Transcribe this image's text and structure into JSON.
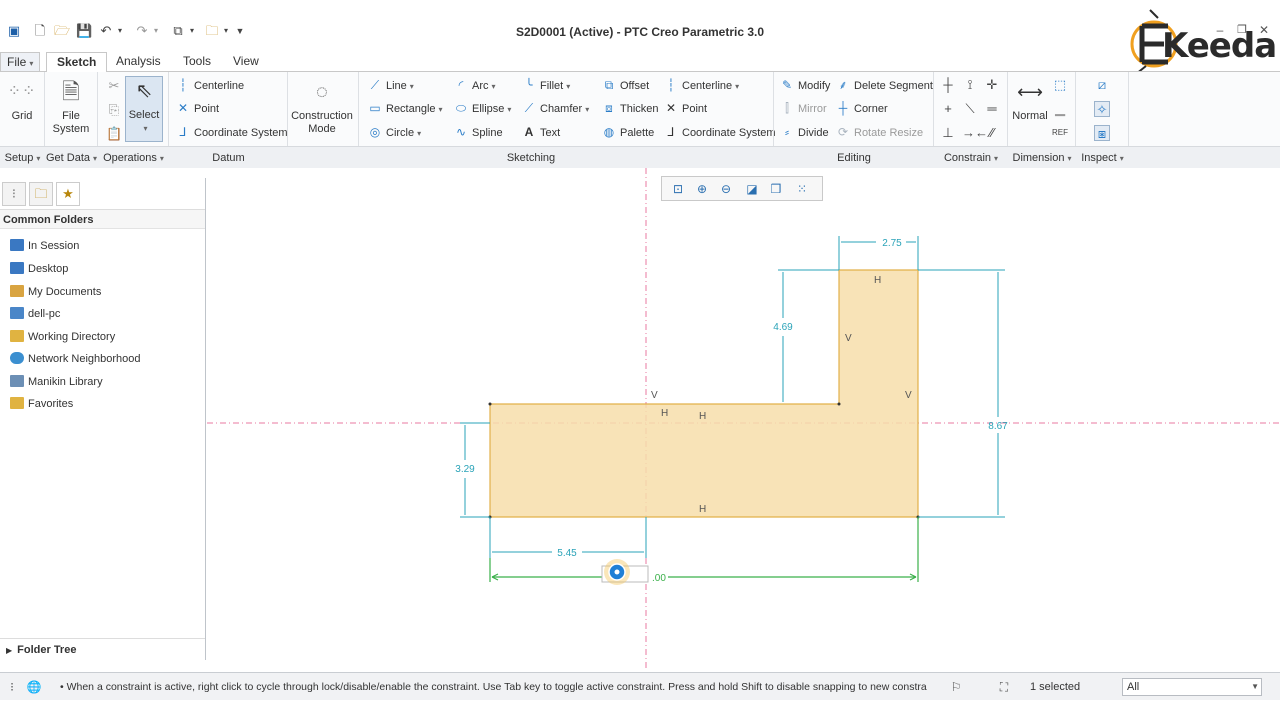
{
  "window": {
    "title": "S2D0001 (Active) - PTC Creo Parametric 3.0"
  },
  "logo": {
    "text": "Keeda"
  },
  "tabs": [
    {
      "label": "File"
    },
    {
      "label": "Sketch"
    },
    {
      "label": "Analysis"
    },
    {
      "label": "Tools"
    },
    {
      "label": "View"
    }
  ],
  "ribbon": {
    "setup": {
      "grid": "Grid",
      "group": "Setup"
    },
    "get_data": {
      "file_system_line1": "File",
      "file_system_line2": "System",
      "group": "Get Data"
    },
    "operations": {
      "select": "Select",
      "group": "Operations"
    },
    "datum": {
      "centerline": "Centerline",
      "point": "Point",
      "coordinate_system": "Coordinate System",
      "group": "Datum"
    },
    "construction": {
      "line1": "Construction",
      "line2": "Mode"
    },
    "sketching": {
      "line": "Line",
      "rectangle": "Rectangle",
      "circle": "Circle",
      "arc": "Arc",
      "ellipse": "Ellipse",
      "spline": "Spline",
      "fillet": "Fillet",
      "chamfer": "Chamfer",
      "text": "Text",
      "offset": "Offset",
      "thicken": "Thicken",
      "palette": "Palette",
      "centerline": "Centerline",
      "point": "Point",
      "coordinate_system": "Coordinate System",
      "group": "Sketching"
    },
    "editing": {
      "modify": "Modify",
      "mirror": "Mirror",
      "divide": "Divide",
      "delete_segment": "Delete Segment",
      "corner": "Corner",
      "rotate_resize": "Rotate Resize",
      "group": "Editing"
    },
    "constrain": {
      "group": "Constrain"
    },
    "dimension": {
      "normal": "Normal",
      "group": "Dimension"
    },
    "inspect": {
      "group": "Inspect"
    }
  },
  "left_pane": {
    "header": "Common Folders",
    "folders": [
      {
        "label": "In Session",
        "color": "#3a78c2"
      },
      {
        "label": "Desktop",
        "color": "#3a78c2"
      },
      {
        "label": "My Documents",
        "color": "#d9a441"
      },
      {
        "label": "dell-pc",
        "color": "#4a86c8"
      },
      {
        "label": "Working Directory",
        "color": "#e0b341"
      },
      {
        "label": "Network Neighborhood",
        "color": "#3b8fd0"
      },
      {
        "label": "Manikin Library",
        "color": "#6c8fb5"
      },
      {
        "label": "Favorites",
        "color": "#e0b341"
      }
    ],
    "footer": "Folder Tree"
  },
  "sketch": {
    "colors": {
      "fill": "#f7deaa",
      "edge": "#e2b14a",
      "dim": "#2aa3b8",
      "active_dim": "#3ab04a",
      "axis": "#e87aa0"
    },
    "dimensions": [
      "2.75",
      "4.69",
      "8.67",
      "3.29",
      "5.45"
    ],
    "active_dimension_value": ".00",
    "constraint_marks": [
      "H",
      "V",
      "V",
      "V",
      "H",
      "H",
      "H"
    ]
  },
  "status": {
    "message": "When a constraint is active, right click to cycle through lock/disable/enable the constraint. Use Tab key to toggle active constraint. Press and hold Shift to disable snapping to new constra",
    "selected": "1 selected",
    "filter": "All"
  }
}
